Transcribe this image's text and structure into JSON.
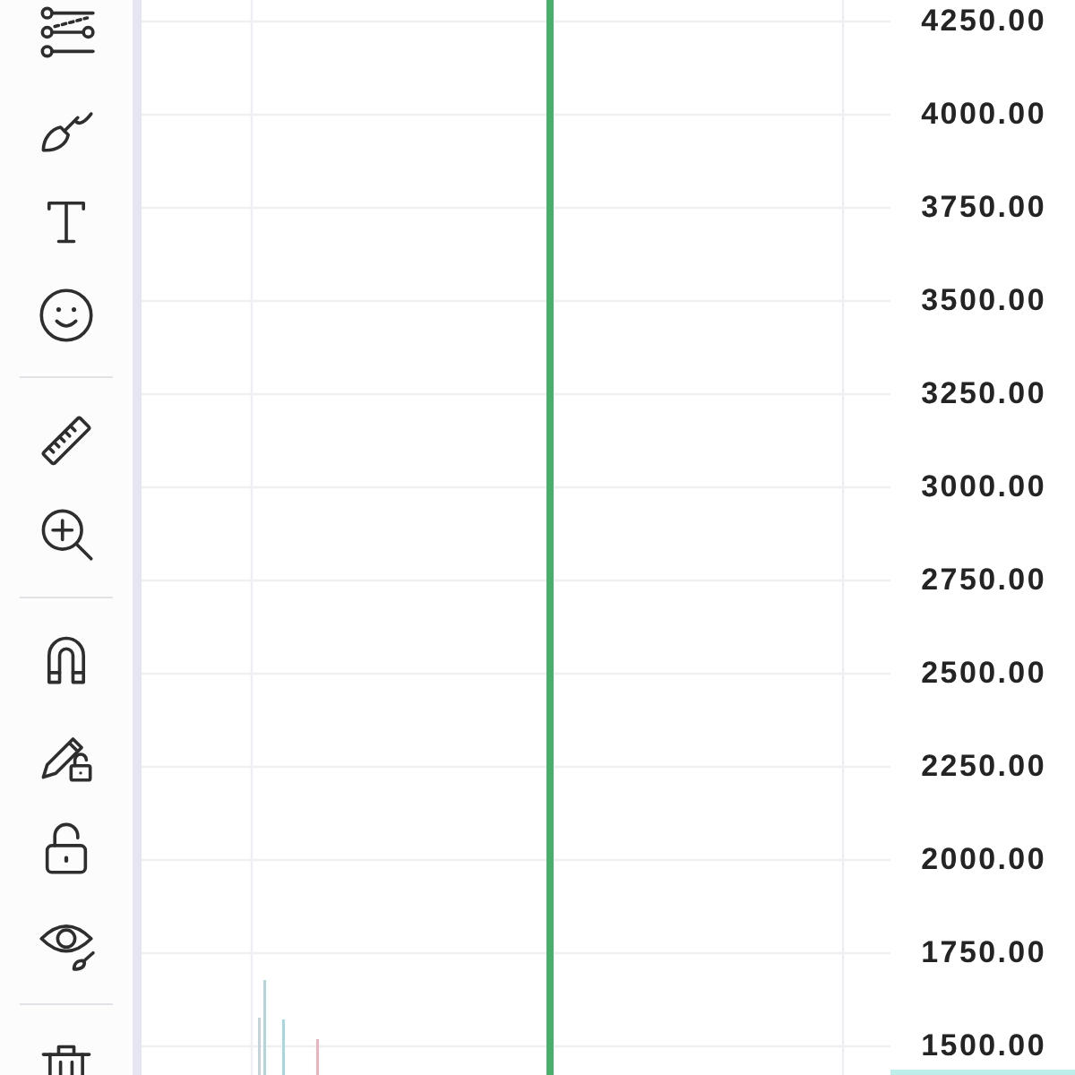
{
  "toolbar": {
    "items": [
      {
        "kind": "button"
      },
      {
        "kind": "button"
      },
      {
        "kind": "button"
      },
      {
        "kind": "button"
      },
      {
        "kind": "divider"
      },
      {
        "kind": "button"
      },
      {
        "kind": "button"
      },
      {
        "kind": "divider"
      },
      {
        "kind": "button"
      },
      {
        "kind": "button"
      },
      {
        "kind": "button"
      },
      {
        "kind": "button"
      },
      {
        "kind": "divider"
      },
      {
        "kind": "button"
      }
    ]
  },
  "price_axis": {
    "labels": [
      "4250.00",
      "4000.00",
      "3750.00",
      "3500.00",
      "3250.00",
      "3000.00",
      "2750.00",
      "2500.00",
      "2250.00",
      "2000.00",
      "1750.00",
      "1500.00"
    ]
  }
}
